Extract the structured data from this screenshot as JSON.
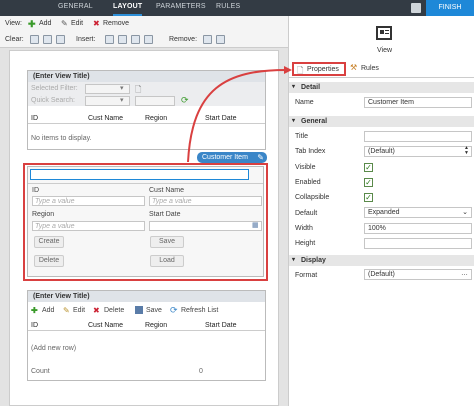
{
  "tabs": [
    "GENERAL",
    "LAYOUT",
    "PARAMETERS",
    "RULES"
  ],
  "finish_label": "FINISH",
  "toolbar": {
    "view_label": "View:",
    "add_label": "Add",
    "edit_label": "Edit",
    "remove_label": "Remove",
    "clear_label": "Clear:",
    "insert_label": "Insert:",
    "remove2_label": "Remove:"
  },
  "list_view": {
    "title": "(Enter View Title)",
    "selected_filter_label": "Selected Filter:",
    "quick_search_label": "Quick Search:",
    "columns": [
      "ID",
      "Cust Name",
      "Region",
      "Start Date"
    ],
    "empty_text": "No items to display."
  },
  "badge_label": "Customer Item",
  "item_view": {
    "fields": [
      {
        "label": "ID",
        "placeholder": "Type a value"
      },
      {
        "label": "Cust Name",
        "placeholder": "Type a value"
      },
      {
        "label": "Region",
        "placeholder": "Type a value"
      },
      {
        "label": "Start Date",
        "placeholder": ""
      }
    ],
    "buttons": [
      "Create",
      "Save",
      "Delete",
      "Load"
    ]
  },
  "editable_list": {
    "title": "(Enter View Title)",
    "actions": [
      "Add",
      "Edit",
      "Delete",
      "Save",
      "Refresh List"
    ],
    "columns": [
      "ID",
      "Cust Name",
      "Region",
      "Start Date"
    ],
    "add_row_text": "(Add new row)",
    "count_label": "Count",
    "count_value": "0"
  },
  "right_panel": {
    "view_label": "View",
    "tab_properties": "Properties",
    "tab_rules": "Rules",
    "detail_title": "Detail",
    "name_label": "Name",
    "name_value": "Customer Item",
    "general_title": "General",
    "title_label": "Title",
    "title_value": "",
    "tabindex_label": "Tab Index",
    "tabindex_value": "(Default)",
    "visible_label": "Visible",
    "enabled_label": "Enabled",
    "collapsible_label": "Collapsible",
    "default_label": "Default",
    "default_value": "Expanded",
    "width_label": "Width",
    "width_value": "100%",
    "height_label": "Height",
    "height_value": "",
    "display_title": "Display",
    "format_label": "Format",
    "format_value": "(Default)"
  },
  "colors": {
    "accent": "#1e88d8",
    "highlight": "#d94040",
    "topbar": "#333b44"
  }
}
